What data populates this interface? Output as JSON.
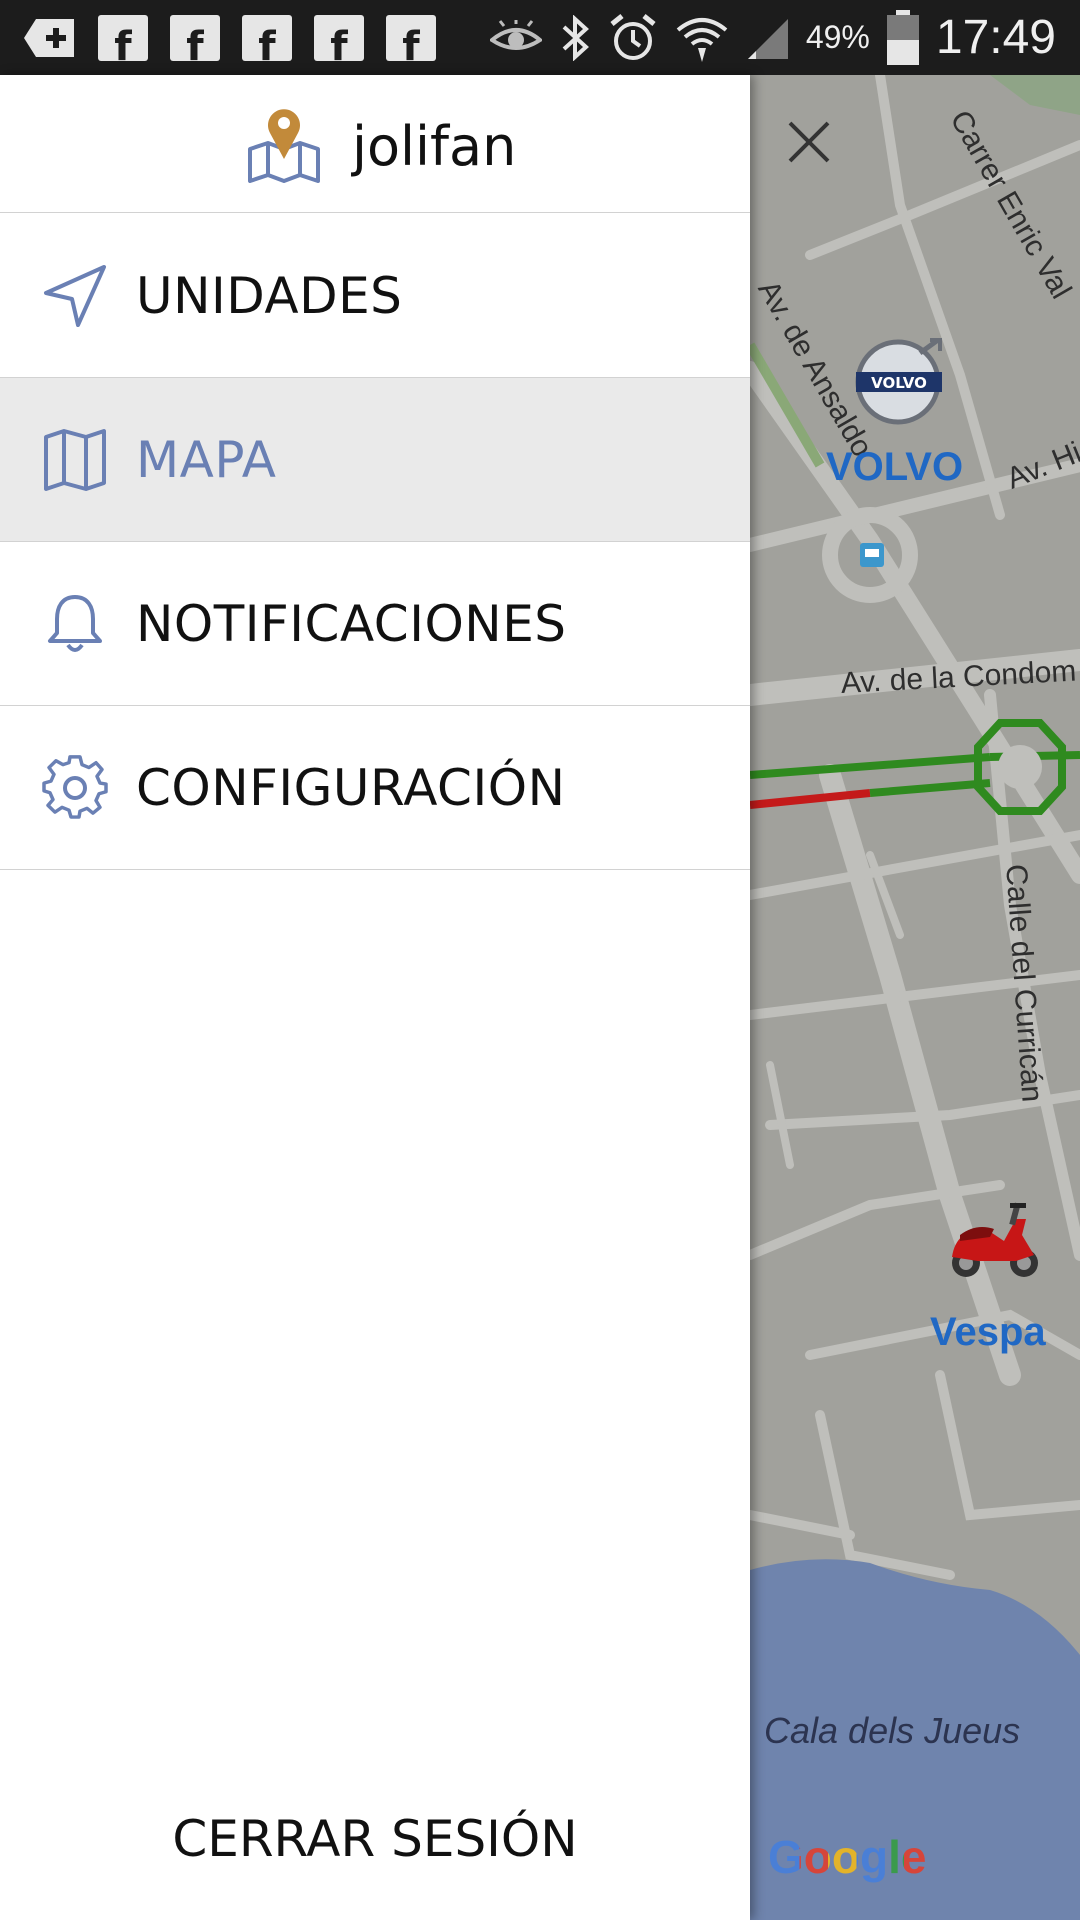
{
  "status_bar": {
    "notification_icons": [
      "add-box-icon",
      "facebook-icon",
      "facebook-icon",
      "facebook-icon",
      "facebook-icon",
      "facebook-icon"
    ],
    "system_icons": [
      "eye-icon",
      "bluetooth-icon",
      "alarm-icon",
      "wifi-icon",
      "signal-icon"
    ],
    "battery": "49%",
    "clock": "17:49"
  },
  "drawer": {
    "username": "jolifan",
    "menu": [
      {
        "label": "UNIDADES",
        "icon": "navigation-arrow-icon",
        "active": false
      },
      {
        "label": "MAPA",
        "icon": "map-icon",
        "active": true
      },
      {
        "label": "NOTIFICACIONES",
        "icon": "bell-icon",
        "active": false
      },
      {
        "label": "CONFIGURACIÓN",
        "icon": "gear-icon",
        "active": false
      }
    ],
    "logout_label": "CERRAR SESIÓN"
  },
  "map": {
    "street_labels": [
      "Av. de Ansaldo",
      "Carrer Enric Val",
      "Av. His",
      "Av. de la Condom",
      "Calle del Curricán"
    ],
    "place_label": "Cala dels Jueus",
    "units": [
      {
        "name": "VOLVO",
        "icon": "volvo-logo-icon"
      },
      {
        "name": "Vespa",
        "icon": "scooter-icon"
      }
    ],
    "attribution": "Google"
  },
  "colors": {
    "accent": "#6a80b4",
    "pin": "#c28a3a",
    "unit_label": "#2068c4",
    "traffic_green": "#2f8a1f",
    "traffic_red": "#c41a1a",
    "water": "#6f84ad"
  }
}
